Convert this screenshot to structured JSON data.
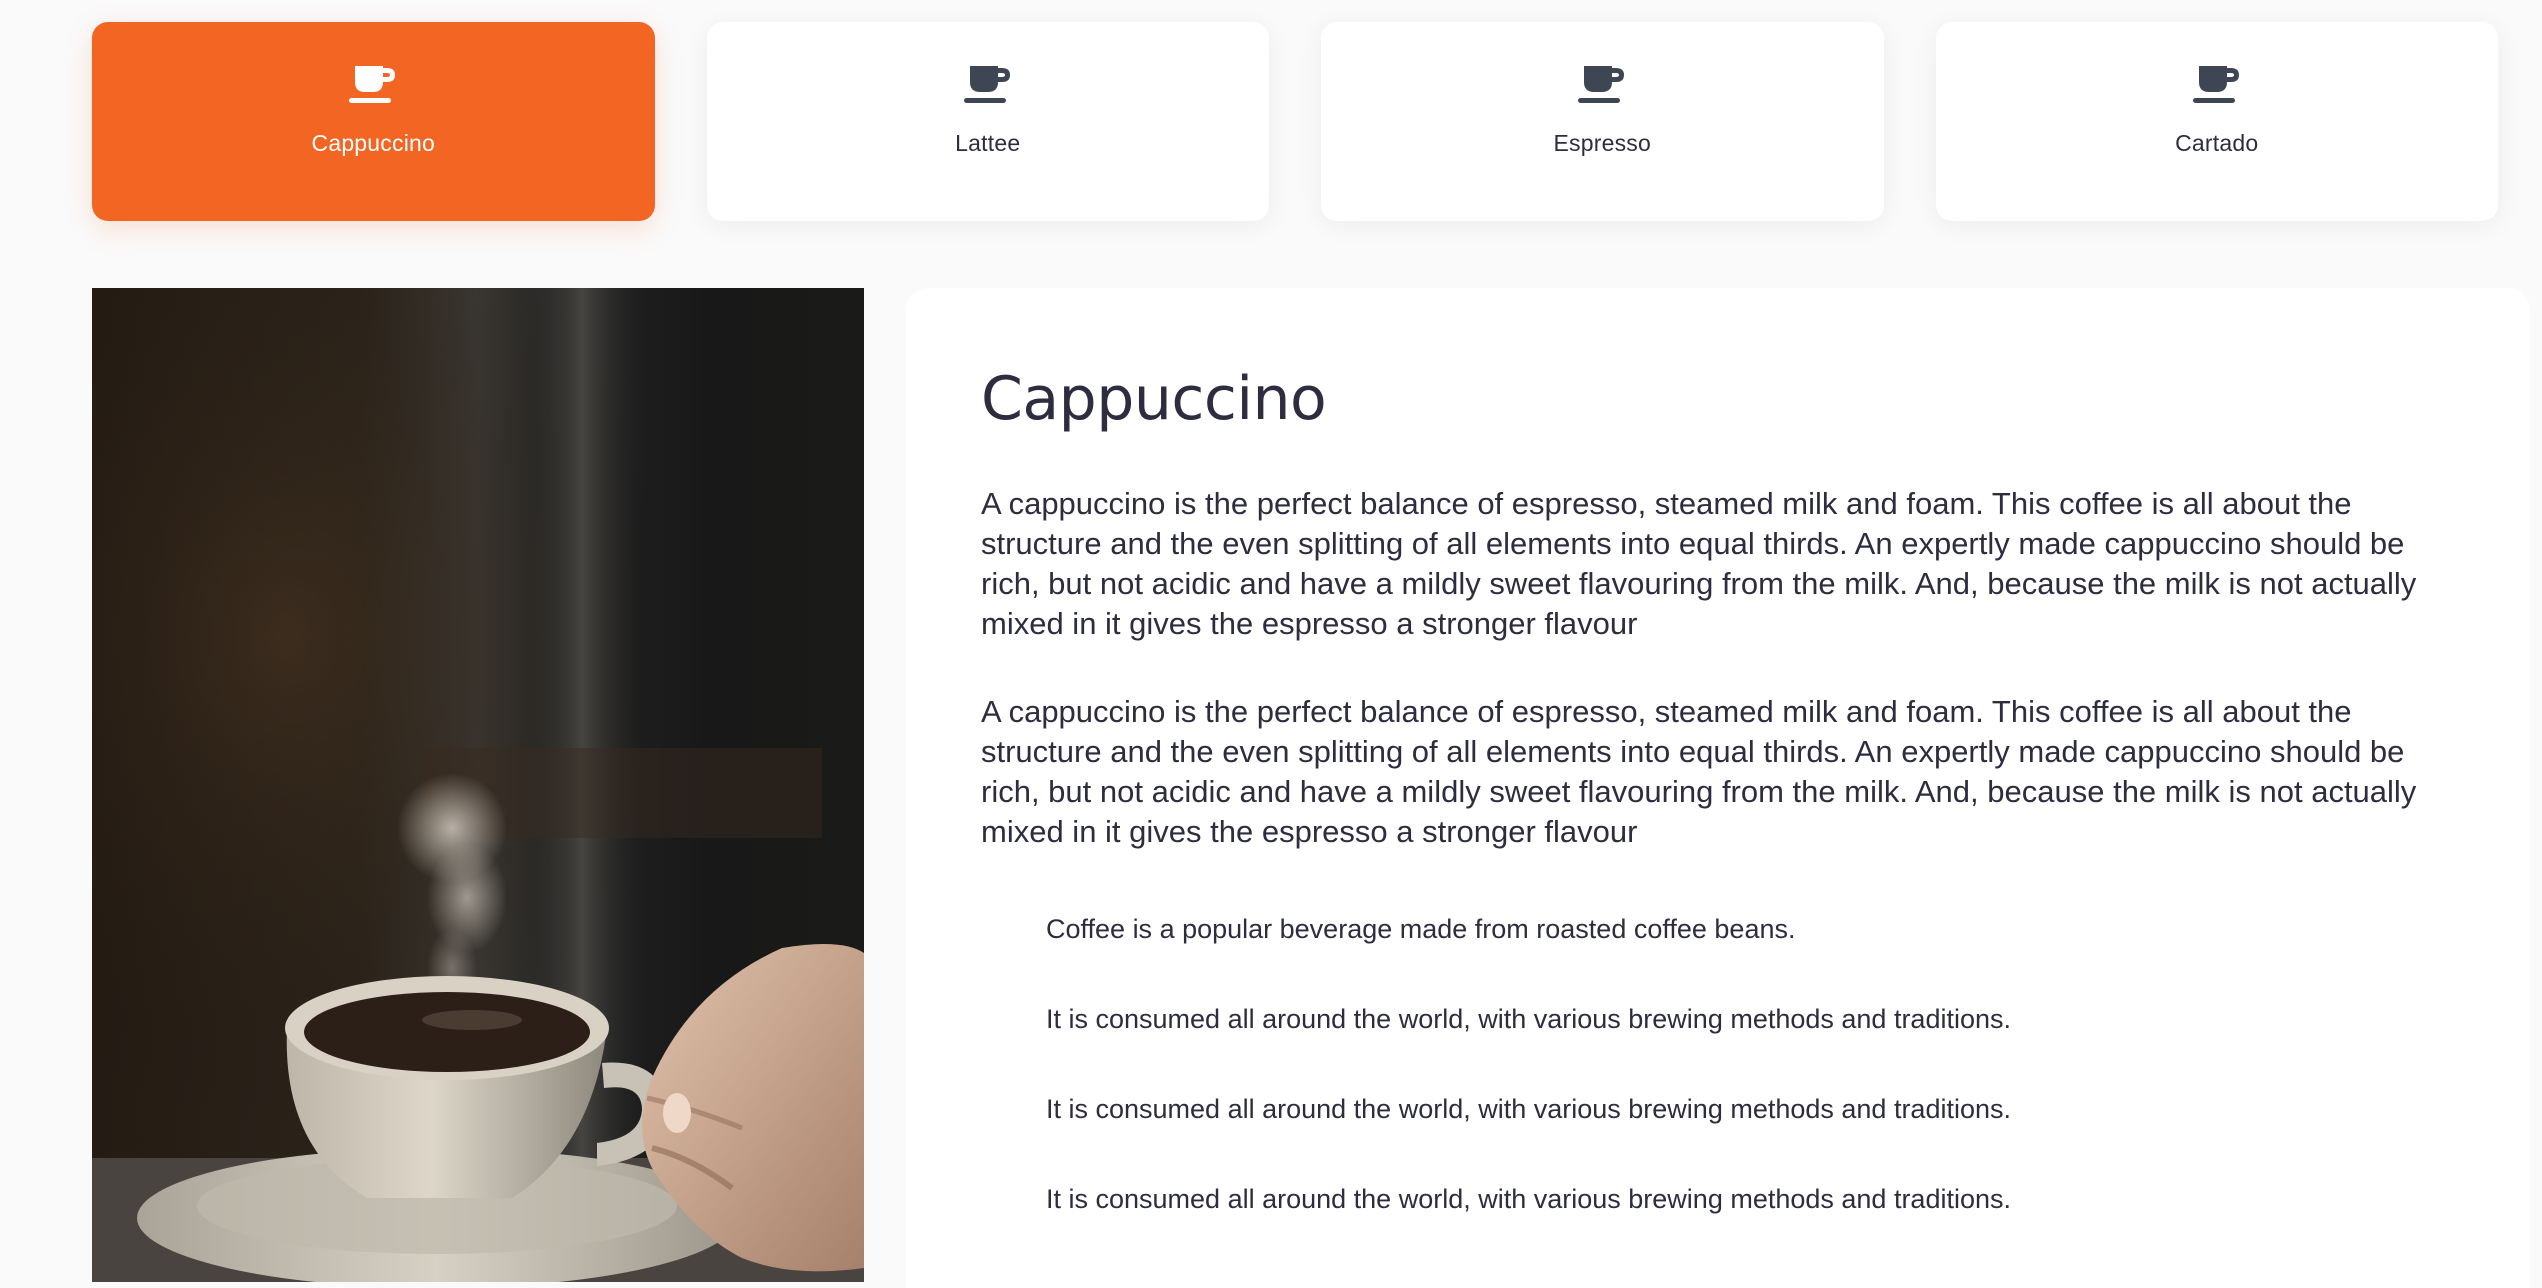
{
  "tabs": [
    {
      "label": "Cappuccino",
      "icon": "coffee-cup-icon",
      "active": true
    },
    {
      "label": "Lattee",
      "icon": "coffee-cup-icon",
      "active": false
    },
    {
      "label": "Espresso",
      "icon": "coffee-cup-icon",
      "active": false
    },
    {
      "label": "Cartado",
      "icon": "coffee-cup-icon",
      "active": false
    }
  ],
  "colors": {
    "accent": "#f26522",
    "text": "#2d2d3f",
    "background": "#fafafa",
    "card": "#ffffff"
  },
  "detail": {
    "title": "Cappuccino",
    "paragraphs": [
      "A cappuccino is the perfect balance of espresso, steamed milk and foam. This coffee is all about the structure and the even splitting of all elements into equal thirds. An expertly made cappuccino should be rich, but not acidic and have a mildly sweet flavouring from the milk. And, because the milk is not actually mixed in it gives the espresso a stronger flavour",
      "A cappuccino is the perfect balance of espresso, steamed milk and foam. This coffee is all about the structure and the even splitting of all elements into equal thirds. An expertly made cappuccino should be rich, but not acidic and have a mildly sweet flavouring from the milk. And, because the milk is not actually mixed in it gives the espresso a stronger flavour"
    ],
    "facts": [
      "Coffee is a popular beverage made from roasted coffee beans.",
      "It is consumed all around the world, with various brewing methods and traditions.",
      "It is consumed all around the world, with various brewing methods and traditions.",
      "It is consumed all around the world, with various brewing methods and traditions."
    ]
  }
}
